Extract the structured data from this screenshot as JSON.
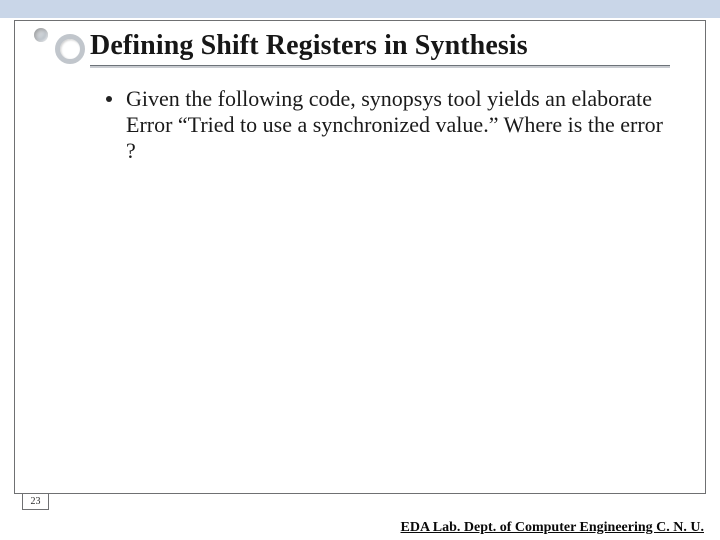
{
  "title": "Defining Shift Registers in Synthesis",
  "bullet": "Given the following code, synopsys tool yields an elaborate Error “Tried to use a synchronized value.” Where is the error ?",
  "page_number": "23",
  "footer": "EDA Lab. Dept. of Computer Engineering C. N. U."
}
